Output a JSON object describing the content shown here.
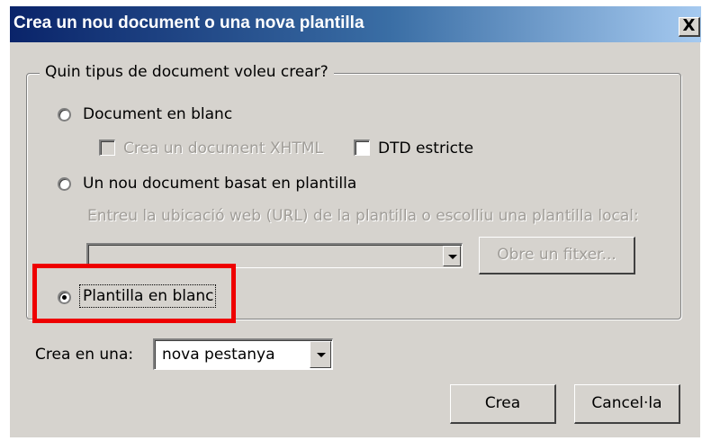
{
  "dialog": {
    "title": "Crea un nou document o una nova plantilla",
    "close_label": "X"
  },
  "group": {
    "legend": "Quin tipus de document voleu crear?",
    "options": {
      "blank_document": {
        "label": "Document en blanc",
        "selected": false
      },
      "xhtml_checkbox": {
        "label": "Crea un document XHTML",
        "checked": false,
        "enabled": false
      },
      "strict_dtd_checkbox": {
        "label": "DTD estricte",
        "checked": false,
        "enabled": true
      },
      "template_document": {
        "label": "Un nou document basat en plantilla",
        "selected": false
      },
      "template_hint": "Entreu la ubicació web (URL) de la plantilla o escolliu una plantilla local:",
      "template_url": {
        "value": ""
      },
      "open_file_button": "Obre un fitxer...",
      "blank_template": {
        "label": "Plantilla en blanc",
        "selected": true
      }
    }
  },
  "create_in": {
    "label": "Crea en una:",
    "value": "nova pestanya"
  },
  "buttons": {
    "create": "Crea",
    "cancel": "Cancel·la"
  },
  "annotation": {
    "color": "#ee0000"
  }
}
